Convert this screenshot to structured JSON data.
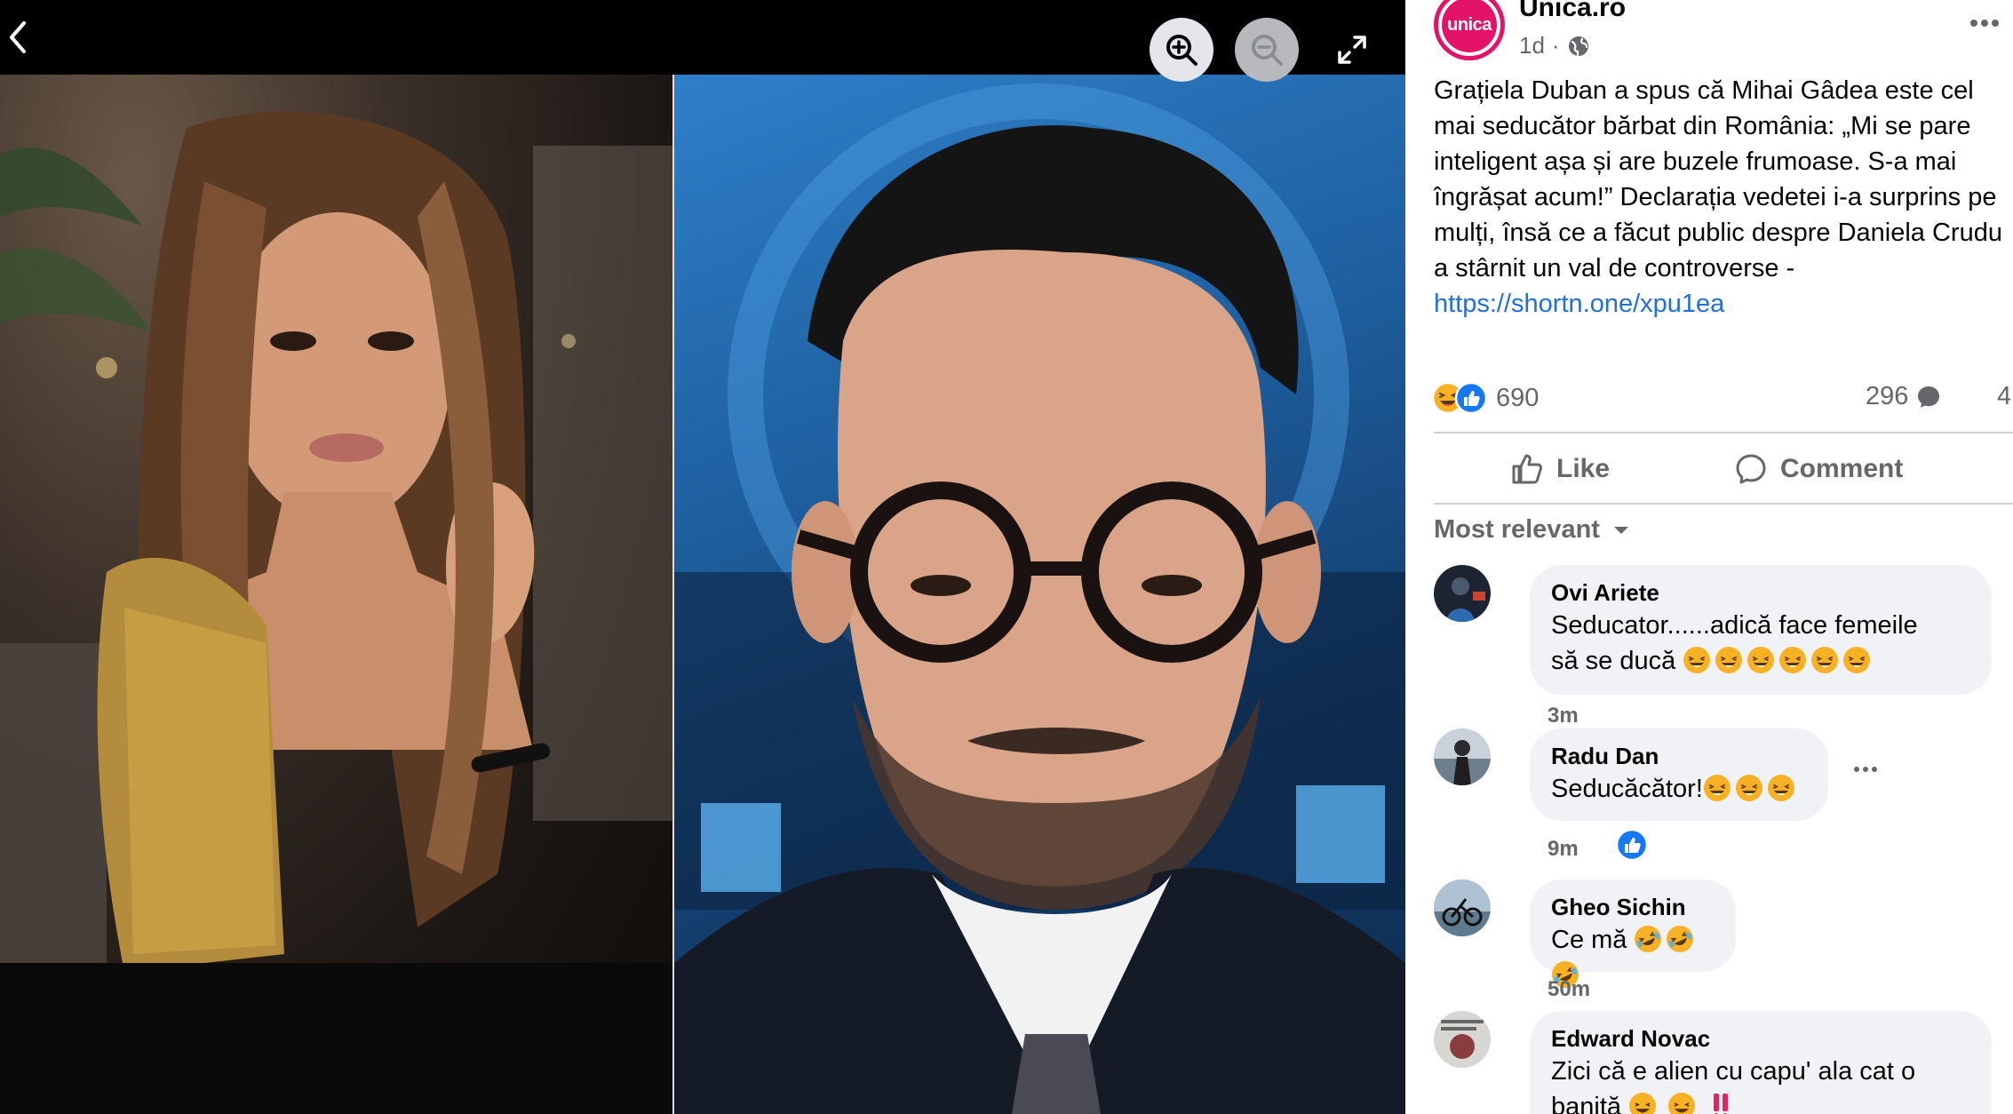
{
  "post": {
    "page_name": "Unica.ro",
    "avatar_text": "unica",
    "time": "1d",
    "separator": "·",
    "text": "Grațiela Duban a spus că Mihai Gâdea este cel mai seducător bărbat din România: „Mi se pare inteligent așa și are buzele frumoase. S-a mai îngrășat acum!” Declarația vedetei i-a surprins pe mulți, însă ce a făcut public despre Daniela Crudu a stârnit un val de controverse -",
    "link": "https://shortn.one/xpu1ea",
    "reaction_count": "690",
    "comment_count": "296",
    "share_count": "4"
  },
  "actions": {
    "like": "Like",
    "comment": "Comment"
  },
  "comments_header": {
    "sort_label": "Most relevant"
  },
  "comments": [
    {
      "author": "Ovi Ariete",
      "text": "Seducator......adică face femeile",
      "text2": "să se ducă",
      "emoji_count": 6,
      "time": "3m"
    },
    {
      "author": "Radu Dan",
      "text": "Seducăcător!",
      "emoji_count": 3,
      "time": "9m"
    },
    {
      "author": "Gheo Sichin",
      "text": "Ce mă",
      "emoji_count": 3,
      "time": "50m"
    },
    {
      "author": "Edward Novac",
      "text": "Zici că e alien cu capu' ala cat o",
      "text2": "baniță"
    }
  ],
  "icons": {
    "back": "chevron-left-icon",
    "zoom_in": "zoom-in-icon",
    "zoom_out": "zoom-out-icon",
    "fullscreen": "fullscreen-icon",
    "more": "more-horizontal-icon",
    "globe": "globe-icon",
    "like": "thumbs-up-icon",
    "comment": "comment-bubble-icon",
    "sort": "caret-down-icon"
  },
  "colors": {
    "brand": "#e4136a",
    "link": "#216fdb",
    "like_blue": "#1877f2",
    "muted": "#65676b",
    "bubble": "#f0f2f5"
  }
}
